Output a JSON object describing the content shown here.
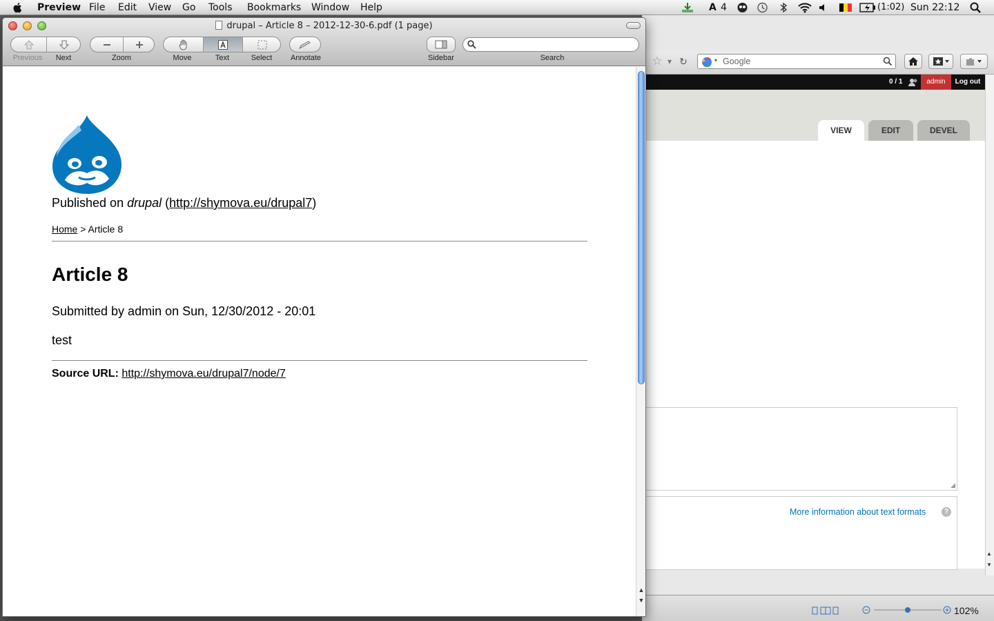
{
  "menubar": {
    "app_name": "Preview",
    "menus": [
      "File",
      "Edit",
      "View",
      "Go",
      "Tools",
      "Bookmarks",
      "Window",
      "Help"
    ],
    "adobe_count": "4",
    "battery": "(1:02)",
    "clock": "Sun 22:12"
  },
  "window": {
    "title": "drupal – Article 8 – 2012-12-30-6.pdf (1 page)",
    "toolbar": {
      "previous": "Previous",
      "next": "Next",
      "zoom": "Zoom",
      "move": "Move",
      "text": "Text",
      "select": "Select",
      "annotate": "Annotate",
      "sidebar": "Sidebar",
      "search": "Search",
      "search_value": ""
    }
  },
  "document": {
    "published_prefix": "Published on ",
    "site_name": "drupal",
    "site_url_open": " (",
    "site_url": "http://shymova.eu/drupal7",
    "site_url_close": ")",
    "breadcrumb_home": "Home",
    "breadcrumb_sep": " > ",
    "breadcrumb_current": "Article 8",
    "title": "Article 8",
    "submitted": "Submitted by admin on Sun, 12/30/2012 - 20:01",
    "body": "test",
    "source_label": "Source URL:",
    "source_url": "http://shymova.eu/drupal7/node/7"
  },
  "browser": {
    "search_placeholder": "Google",
    "admin_count": "0 / 1",
    "admin_user": "admin",
    "logout": "Log out",
    "tabs": [
      "VIEW",
      "EDIT",
      "DEVEL"
    ],
    "more_info": "More information about text formats",
    "help_glyph": "?",
    "zoom_level": "102%"
  },
  "colors": {
    "drupal_blue": "#0678be",
    "admin_red": "#c23333",
    "link_blue": "#0074bd"
  }
}
